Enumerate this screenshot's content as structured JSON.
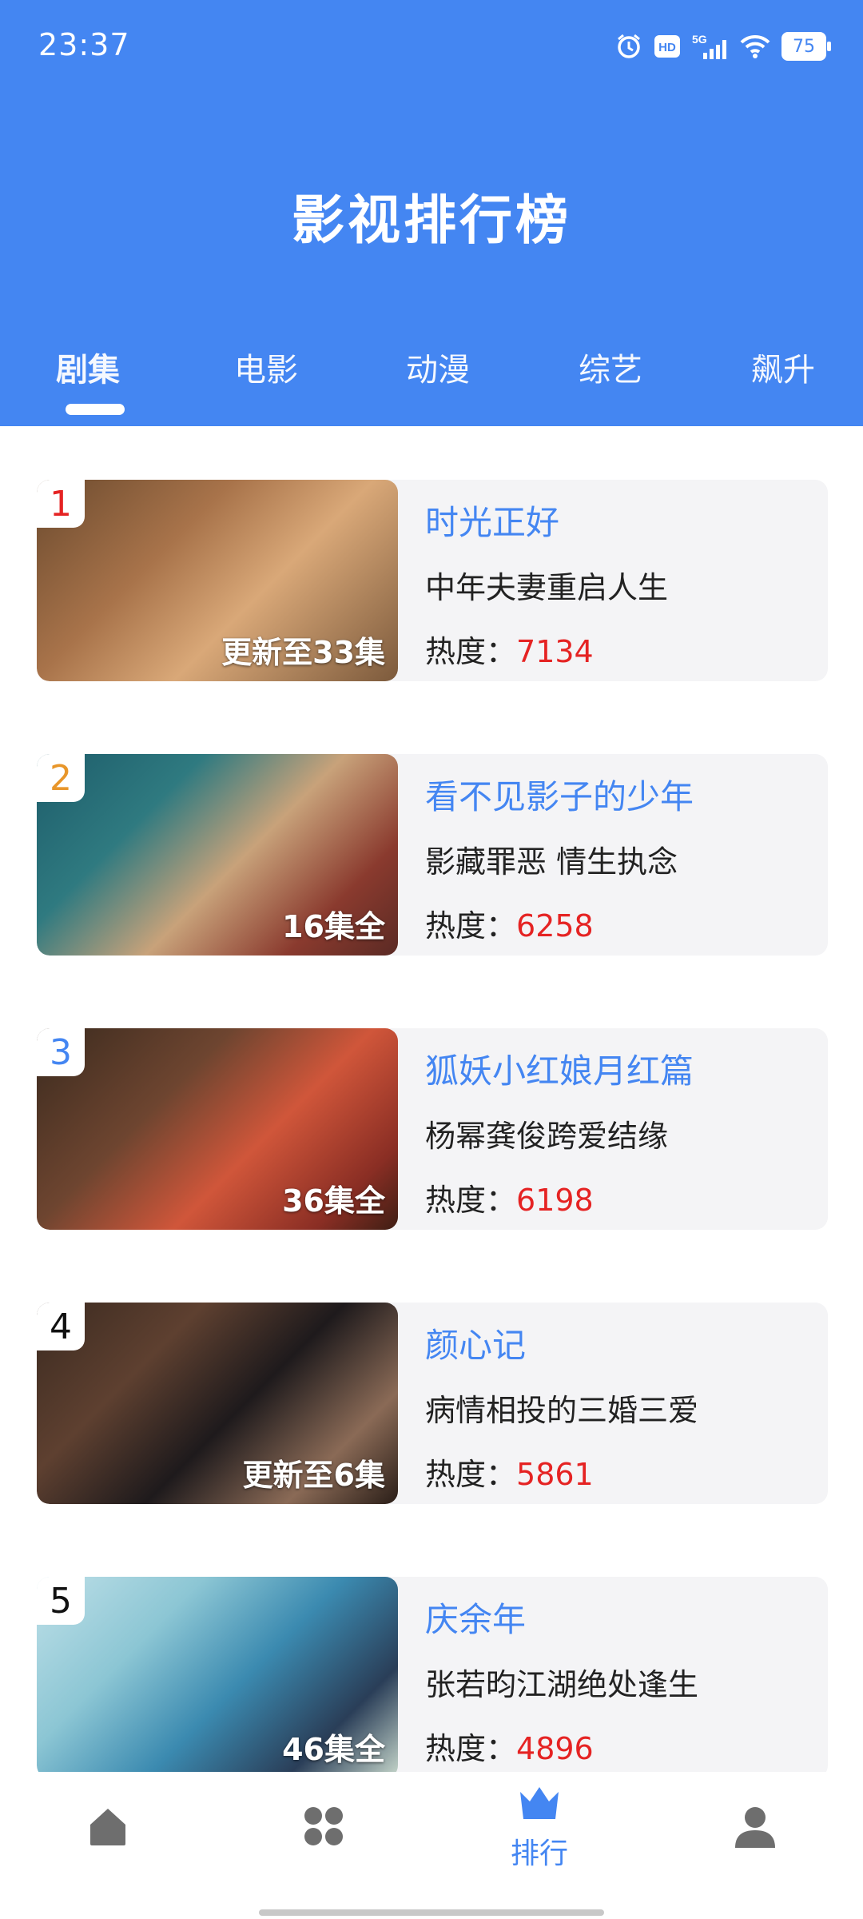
{
  "status": {
    "time": "23:37",
    "battery": "75",
    "network": "5G",
    "hd": "HD"
  },
  "app": {
    "title": "影视排行榜"
  },
  "tabs": [
    {
      "label": "剧集"
    },
    {
      "label": "电影"
    },
    {
      "label": "动漫"
    },
    {
      "label": "综艺"
    },
    {
      "label": "飙升"
    }
  ],
  "items": [
    {
      "rank": "1",
      "title": "时光正好",
      "desc": "中年夫妻重启人生",
      "heat_label": "热度：",
      "heat": "7134",
      "episodes": "更新至33集"
    },
    {
      "rank": "2",
      "title": "看不见影子的少年",
      "desc": "影藏罪恶 情生执念",
      "heat_label": "热度：",
      "heat": "6258",
      "episodes": "16集全"
    },
    {
      "rank": "3",
      "title": "狐妖小红娘月红篇",
      "desc": "杨幂龚俊跨爱结缘",
      "heat_label": "热度：",
      "heat": "6198",
      "episodes": "36集全"
    },
    {
      "rank": "4",
      "title": "颜心记",
      "desc": "病情相投的三婚三爱",
      "heat_label": "热度：",
      "heat": "5861",
      "episodes": "更新至6集"
    },
    {
      "rank": "5",
      "title": "庆余年",
      "desc": "张若昀江湖绝处逢生",
      "heat_label": "热度：",
      "heat": "4896",
      "episodes": "46集全"
    }
  ],
  "nav": {
    "rank_label": "排行"
  },
  "colors": {
    "primary": "#4486f2",
    "heat": "#e52323",
    "rank1": "#e52323",
    "rank2": "#e8962a",
    "rank3": "#4486f2",
    "rank_other": "#111111"
  }
}
